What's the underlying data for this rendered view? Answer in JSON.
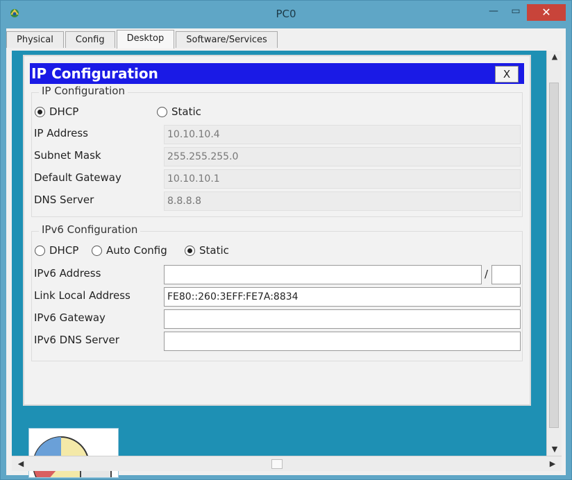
{
  "window": {
    "title": "PC0",
    "min_label": "—",
    "max_label": "▭",
    "close_label": "✕"
  },
  "tabs": [
    {
      "label": "Physical",
      "active": false
    },
    {
      "label": "Config",
      "active": false
    },
    {
      "label": "Desktop",
      "active": true
    },
    {
      "label": "Software/Services",
      "active": false
    }
  ],
  "ipcfg": {
    "title": "IP Configuration",
    "close_label": "X",
    "ipv4": {
      "legend": "IP Configuration",
      "dhcp_label": "DHCP",
      "static_label": "Static",
      "selected": "DHCP",
      "fields": [
        {
          "label": "IP Address",
          "value": "10.10.10.4"
        },
        {
          "label": "Subnet Mask",
          "value": "255.255.255.0"
        },
        {
          "label": "Default Gateway",
          "value": "10.10.10.1"
        },
        {
          "label": "DNS Server",
          "value": "8.8.8.8"
        }
      ]
    },
    "ipv6": {
      "legend": "IPv6 Configuration",
      "dhcp_label": "DHCP",
      "auto_label": "Auto Config",
      "static_label": "Static",
      "selected": "Static",
      "address_label": "IPv6 Address",
      "address_value": "",
      "prefix_sep": "/",
      "prefix_value": "",
      "link_local_label": "Link Local Address",
      "link_local_value": "FE80::260:3EFF:FE7A:8834",
      "gateway_label": "IPv6 Gateway",
      "gateway_value": "",
      "dns_label": "IPv6 DNS Server",
      "dns_value": ""
    }
  },
  "scroll": {
    "up": "▲",
    "down": "▼",
    "left": "◀",
    "right": "▶"
  },
  "colors": {
    "window_frame": "#5fa6c6",
    "desktop_bg": "#1e90b4",
    "header_blue": "#1a1ae6",
    "close_red": "#c8443a"
  }
}
